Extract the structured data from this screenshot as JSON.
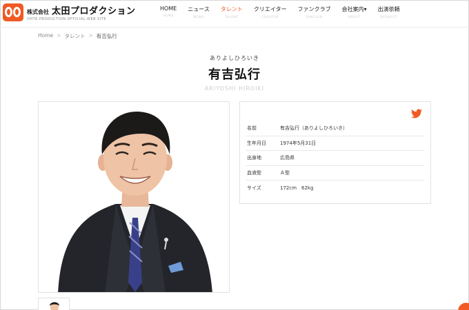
{
  "header": {
    "logo_company": "株式会社",
    "logo_name": "太田プロダクション",
    "logo_sub": "OHTA PRODUCTION OFFICIAL WEB SITE",
    "nav": [
      {
        "jp": "HOME",
        "en": "HOME",
        "active": false
      },
      {
        "jp": "ニュース",
        "en": "NEWS",
        "active": false
      },
      {
        "jp": "タレント",
        "en": "TALENT",
        "active": true
      },
      {
        "jp": "クリエイター",
        "en": "CREATOR",
        "active": false
      },
      {
        "jp": "ファンクラブ",
        "en": "FANCLUB",
        "active": false
      },
      {
        "jp": "会社案内▾",
        "en": "ABOUT",
        "active": false
      },
      {
        "jp": "出演依頼",
        "en": "REQUEST",
        "active": false
      }
    ]
  },
  "breadcrumb": {
    "home": "Home",
    "sep": ">",
    "category": "タレント",
    "current": "有吉弘行"
  },
  "talent": {
    "ruby": "ありよしひろいき",
    "name_jp": "有吉弘行",
    "name_en": "ARIYOSHI HIROIKI"
  },
  "profile": {
    "rows": [
      {
        "label": "名前",
        "value": "有吉弘行（ありよしひろいき）"
      },
      {
        "label": "生年月日",
        "value": "1974年5月31日"
      },
      {
        "label": "出身地",
        "value": "広島県"
      },
      {
        "label": "血液型",
        "value": "Ａ型"
      },
      {
        "label": "サイズ",
        "value": "172cm　62kg"
      }
    ]
  },
  "colors": {
    "accent": "#f05a24",
    "twitter": "#f05a24"
  }
}
